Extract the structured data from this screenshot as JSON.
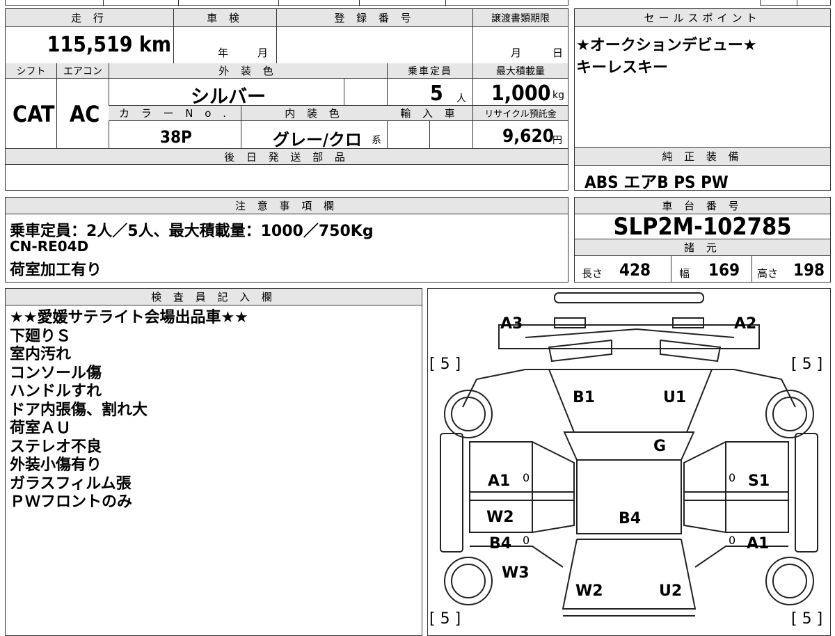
{
  "top": {
    "mileage_header": "走 行",
    "mileage": "115,519 km",
    "inspection_header": "車 検",
    "inspection_year": "年",
    "inspection_month": "月",
    "reg_header": "登 録 番 号",
    "transfer_header": "譲渡書類期限",
    "transfer_month": "月",
    "transfer_day": "日"
  },
  "mid": {
    "shift_header": "シフト",
    "shift": "CAT",
    "ac_header": "エアコン",
    "ac": "AC",
    "exterior_header": "外 装 色",
    "exterior": "シルバー",
    "capacity_header": "乗車定員",
    "capacity": "5",
    "capacity_unit": "人",
    "load_header": "最大積載量",
    "load": "1,000",
    "load_unit": "kg",
    "color_no_header": "カ ラ ー N o .",
    "color_no": "38P",
    "interior_header": "内 装 色",
    "interior": "グレー/クロ",
    "interior_suffix": "系",
    "import_header": "輸 入 車",
    "recycle_header": "リサイクル預託金",
    "recycle": "9,620",
    "recycle_unit": "円",
    "later_parts_header": "後 日 発 送 部 品"
  },
  "sales": {
    "header": "セールスポイント",
    "lines": [
      "★オークションデビュー★",
      "キーレスキー"
    ]
  },
  "equipment": {
    "header": "純 正 装 備",
    "value": "ABS エアB PS PW"
  },
  "notes": {
    "header": "注 意 事 項 欄",
    "lines": [
      "乗車定員：2人／5人、最大積載量：1000／750Kg",
      "CN-RE04D",
      "荷室加工有り"
    ]
  },
  "chassis": {
    "header": "車 台 番 号",
    "value": "SLP2M-102785"
  },
  "specs": {
    "header": "諸 元",
    "length_label": "長さ",
    "length": "428",
    "width_label": "幅",
    "width": "169",
    "height_label": "高さ",
    "height": "198"
  },
  "inspector": {
    "header": "検 査 員 記 入 欄",
    "lines": [
      "★★愛媛サテライト会場出品車★★",
      "下廻りＳ",
      "室内汚れ",
      "コンソール傷",
      "ハンドルすれ",
      "ドア内張傷、割れ大",
      "荷室ＡＵ",
      "ステレオ不良",
      "外装小傷有り",
      "ガラスフィルム張",
      "ＰＷフロントのみ"
    ]
  },
  "diagram": {
    "tire_fl": "[ 5 ]",
    "tire_fr": "[ 5 ]",
    "tire_rl": "[ 5 ]",
    "tire_rr": "[ 5 ]",
    "a3": "A3",
    "a2": "A2",
    "b1": "B1",
    "u1": "U1",
    "g": "G",
    "a1_left": "A1",
    "s1": "S1",
    "w2_left": "W2",
    "b4_center": "B4",
    "b4_left": "B4",
    "a1_right": "A1",
    "w3": "W3",
    "w2_bottom": "W2",
    "u2": "U2",
    "zero": "0"
  }
}
